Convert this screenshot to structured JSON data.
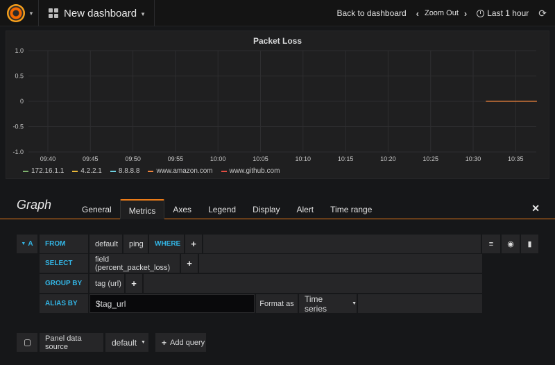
{
  "navbar": {
    "dashboard_title": "New dashboard",
    "back_label": "Back to dashboard",
    "zoom_out_label": "Zoom Out",
    "time_range_label": "Last 1 hour"
  },
  "panel": {
    "title": "Packet Loss"
  },
  "chart_data": {
    "type": "line",
    "title": "Packet Loss",
    "y_ticks": [
      "1.0",
      "0.5",
      "0",
      "-0.5",
      "-1.0"
    ],
    "ylim": [
      -1.0,
      1.0
    ],
    "x_ticks": [
      "09:40",
      "09:45",
      "09:50",
      "09:55",
      "10:00",
      "10:05",
      "10:10",
      "10:15",
      "10:20",
      "10:25",
      "10:30",
      "10:35"
    ],
    "grid": true,
    "legend_position": "bottom-left",
    "series": [
      {
        "name": "172.16.1.1",
        "color": "#7eb26d",
        "points": []
      },
      {
        "name": "4.2.2.1",
        "color": "#eab839",
        "points": []
      },
      {
        "name": "8.8.8.8",
        "color": "#6ed0e0",
        "points": []
      },
      {
        "name": "www.amazon.com",
        "color": "#ef843c",
        "points": [
          [
            "10:31:30",
            0
          ],
          [
            "10:37:30",
            0
          ]
        ]
      },
      {
        "name": "www.github.com",
        "color": "#e24d42",
        "points": []
      }
    ]
  },
  "editor": {
    "title": "Graph",
    "tabs": [
      "General",
      "Metrics",
      "Axes",
      "Legend",
      "Display",
      "Alert",
      "Time range"
    ],
    "active_tab": "Metrics",
    "query": {
      "ref_id": "A",
      "from_label": "FROM",
      "from_policy": "default",
      "from_measurement": "ping",
      "where_label": "WHERE",
      "select_label": "SELECT",
      "select_value": "field (percent_packet_loss)",
      "group_by_label": "GROUP BY",
      "group_by_value": "tag (url)",
      "alias_label": "ALIAS BY",
      "alias_value": "$tag_url",
      "format_label": "Format as",
      "format_value": "Time series"
    },
    "datasource_label": "Panel data source",
    "datasource_value": "default",
    "add_query_label": "Add query"
  },
  "icons": {
    "logo": "grafana-logo-icon",
    "dashboard": "dashboard-grid-icon",
    "clock": "clock-icon",
    "refresh": "refresh-icon",
    "close": "close-icon",
    "menu": "hamburger-icon",
    "eye": "eye-icon",
    "trash": "trash-icon",
    "database": "database-icon"
  },
  "colors": {
    "accent": "#eb7b18",
    "keyword": "#33b5e5"
  }
}
